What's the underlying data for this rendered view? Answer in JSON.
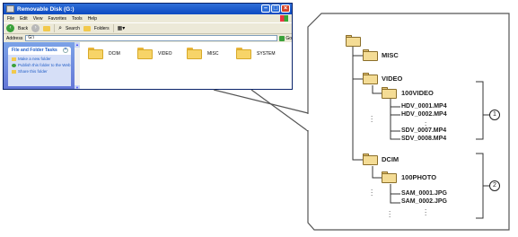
{
  "window": {
    "title": "Removable Disk (G:)",
    "menu": [
      "File",
      "Edit",
      "View",
      "Favorites",
      "Tools",
      "Help"
    ],
    "toolbar": {
      "back": "Back",
      "search": "Search",
      "folders": "Folders"
    },
    "address": {
      "label": "Address",
      "value": "G:\\",
      "go": "Go"
    },
    "tasks": {
      "header": "File and Folder Tasks",
      "items": [
        "Make a new folder",
        "Publish this folder to the Web",
        "Share this folder"
      ]
    },
    "files": [
      "DCIM",
      "VIDEO",
      "MISC",
      "SYSTEM"
    ]
  },
  "tree": {
    "misc": "MISC",
    "video": "VIDEO",
    "video_sub": "100VIDEO",
    "video_files": [
      "HDV_0001.MP4",
      "HDV_0002.MP4",
      "SDV_0007.MP4",
      "SDV_0008.MP4"
    ],
    "dcim": "DCIM",
    "dcim_sub": "100PHOTO",
    "dcim_files": [
      "SAM_0001.JPG",
      "SAM_0002.JPG"
    ],
    "callout_1": "1",
    "callout_2": "2"
  },
  "colors": {
    "titlebar": "#0b49c1",
    "folder": "#f4dc95",
    "taskpane": "#6375d6"
  }
}
